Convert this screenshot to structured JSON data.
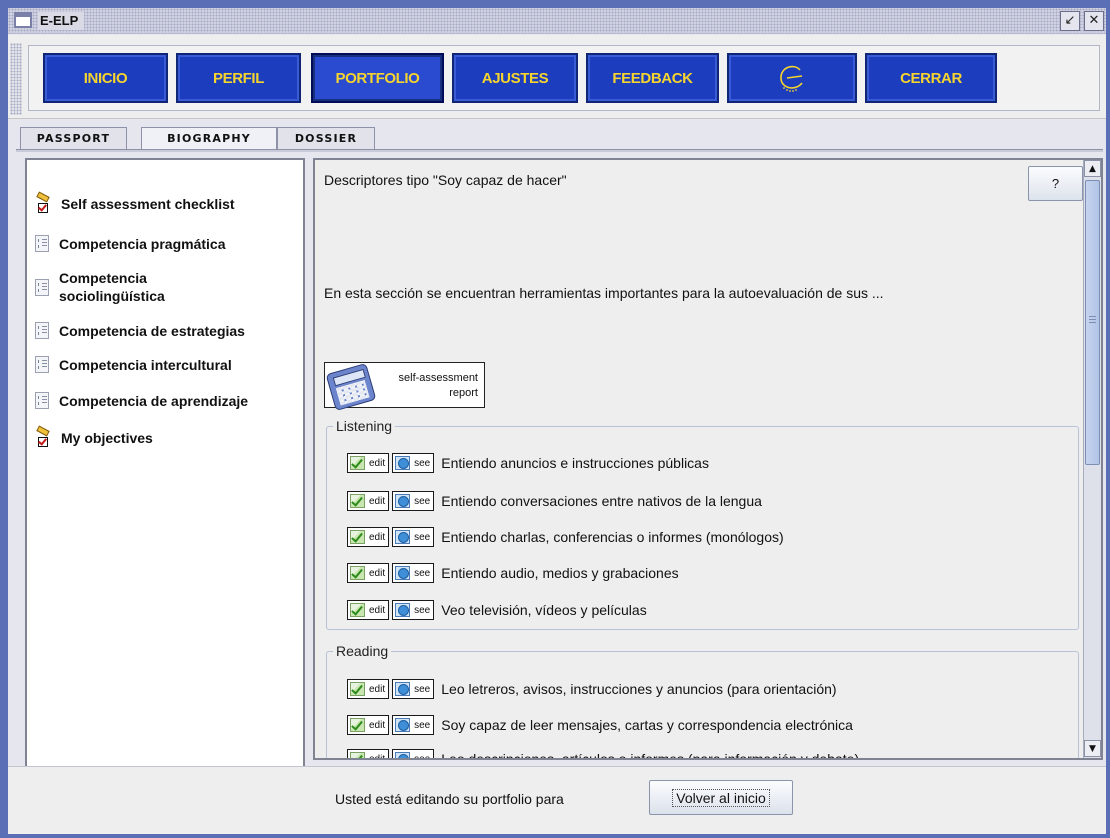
{
  "window": {
    "title": "E-ELP",
    "restore_icon": "restore-icon",
    "close_icon": "close-icon"
  },
  "nav": {
    "buttons": [
      {
        "label": "INICIO"
      },
      {
        "label": "PERFIL"
      },
      {
        "label": "PORTFOLIO",
        "active": true
      },
      {
        "label": "AJUSTES"
      },
      {
        "label": "FEEDBACK"
      },
      {
        "icon": "council-of-europe-logo-icon"
      },
      {
        "label": "CERRAR"
      }
    ],
    "colors": {
      "button_bg": "#1b3dbe",
      "button_text": "#f5d42e"
    }
  },
  "tabs": [
    {
      "label": "PASSPORT"
    },
    {
      "label": "BIOGRAPHY",
      "selected": true
    },
    {
      "label": "DOSSIER"
    }
  ],
  "sidebar": {
    "items": [
      {
        "label": "Self assessment checklist",
        "icon": "checklist-pencil-icon"
      },
      {
        "label": "Competencia pragmática",
        "icon": "document-icon"
      },
      {
        "label": "Competencia sociolingüística",
        "icon": "document-icon"
      },
      {
        "label": "Competencia de estrategias",
        "icon": "document-icon"
      },
      {
        "label": "Competencia intercultural",
        "icon": "document-icon"
      },
      {
        "label": "Competencia de aprendizaje",
        "icon": "document-icon"
      },
      {
        "label": "My objectives",
        "icon": "checklist-pencil-icon"
      }
    ]
  },
  "content": {
    "title": "Descriptores tipo \"Soy capaz de hacer\"",
    "help_label": "?",
    "intro": "En esta sección se encuentran herramientas importantes para la autoevaluación de sus ...",
    "report_button": {
      "line1": "self-assessment",
      "line2": "report",
      "icon": "calculator-icon"
    },
    "edit_label": "edit",
    "see_label": "see",
    "groups": [
      {
        "legend": "Listening",
        "items": [
          "Entiendo  anuncios e instrucciones públicas",
          "Entiendo conversaciones entre nativos de la lengua",
          "Entiendo charlas, conferencias o informes (monólogos)",
          "Entiendo audio, medios y grabaciones",
          "Veo televisión, vídeos y películas"
        ]
      },
      {
        "legend": "Reading",
        "items": [
          "Leo letreros, avisos, instrucciones y anuncios (para orientación)",
          "Soy capaz de leer mensajes, cartas y correspondencia electrónica",
          "Leo descripciones, artículos o informes (para información y debate)"
        ]
      }
    ]
  },
  "footer": {
    "text": "Usted está editando su portfolio para",
    "button_label": "Volver al inicio"
  }
}
